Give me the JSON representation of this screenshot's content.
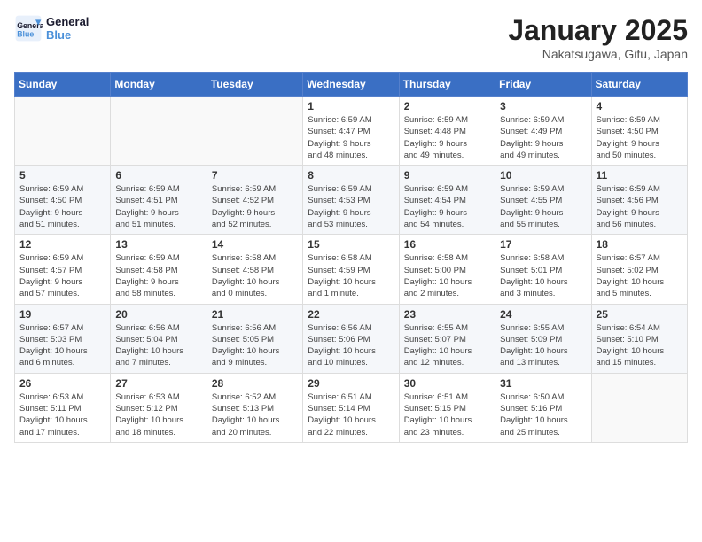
{
  "logo": {
    "line1": "General",
    "line2": "Blue"
  },
  "title": "January 2025",
  "location": "Nakatsugawa, Gifu, Japan",
  "weekdays": [
    "Sunday",
    "Monday",
    "Tuesday",
    "Wednesday",
    "Thursday",
    "Friday",
    "Saturday"
  ],
  "weeks": [
    [
      {
        "day": "",
        "info": ""
      },
      {
        "day": "",
        "info": ""
      },
      {
        "day": "",
        "info": ""
      },
      {
        "day": "1",
        "info": "Sunrise: 6:59 AM\nSunset: 4:47 PM\nDaylight: 9 hours\nand 48 minutes."
      },
      {
        "day": "2",
        "info": "Sunrise: 6:59 AM\nSunset: 4:48 PM\nDaylight: 9 hours\nand 49 minutes."
      },
      {
        "day": "3",
        "info": "Sunrise: 6:59 AM\nSunset: 4:49 PM\nDaylight: 9 hours\nand 49 minutes."
      },
      {
        "day": "4",
        "info": "Sunrise: 6:59 AM\nSunset: 4:50 PM\nDaylight: 9 hours\nand 50 minutes."
      }
    ],
    [
      {
        "day": "5",
        "info": "Sunrise: 6:59 AM\nSunset: 4:50 PM\nDaylight: 9 hours\nand 51 minutes."
      },
      {
        "day": "6",
        "info": "Sunrise: 6:59 AM\nSunset: 4:51 PM\nDaylight: 9 hours\nand 51 minutes."
      },
      {
        "day": "7",
        "info": "Sunrise: 6:59 AM\nSunset: 4:52 PM\nDaylight: 9 hours\nand 52 minutes."
      },
      {
        "day": "8",
        "info": "Sunrise: 6:59 AM\nSunset: 4:53 PM\nDaylight: 9 hours\nand 53 minutes."
      },
      {
        "day": "9",
        "info": "Sunrise: 6:59 AM\nSunset: 4:54 PM\nDaylight: 9 hours\nand 54 minutes."
      },
      {
        "day": "10",
        "info": "Sunrise: 6:59 AM\nSunset: 4:55 PM\nDaylight: 9 hours\nand 55 minutes."
      },
      {
        "day": "11",
        "info": "Sunrise: 6:59 AM\nSunset: 4:56 PM\nDaylight: 9 hours\nand 56 minutes."
      }
    ],
    [
      {
        "day": "12",
        "info": "Sunrise: 6:59 AM\nSunset: 4:57 PM\nDaylight: 9 hours\nand 57 minutes."
      },
      {
        "day": "13",
        "info": "Sunrise: 6:59 AM\nSunset: 4:58 PM\nDaylight: 9 hours\nand 58 minutes."
      },
      {
        "day": "14",
        "info": "Sunrise: 6:58 AM\nSunset: 4:58 PM\nDaylight: 10 hours\nand 0 minutes."
      },
      {
        "day": "15",
        "info": "Sunrise: 6:58 AM\nSunset: 4:59 PM\nDaylight: 10 hours\nand 1 minute."
      },
      {
        "day": "16",
        "info": "Sunrise: 6:58 AM\nSunset: 5:00 PM\nDaylight: 10 hours\nand 2 minutes."
      },
      {
        "day": "17",
        "info": "Sunrise: 6:58 AM\nSunset: 5:01 PM\nDaylight: 10 hours\nand 3 minutes."
      },
      {
        "day": "18",
        "info": "Sunrise: 6:57 AM\nSunset: 5:02 PM\nDaylight: 10 hours\nand 5 minutes."
      }
    ],
    [
      {
        "day": "19",
        "info": "Sunrise: 6:57 AM\nSunset: 5:03 PM\nDaylight: 10 hours\nand 6 minutes."
      },
      {
        "day": "20",
        "info": "Sunrise: 6:56 AM\nSunset: 5:04 PM\nDaylight: 10 hours\nand 7 minutes."
      },
      {
        "day": "21",
        "info": "Sunrise: 6:56 AM\nSunset: 5:05 PM\nDaylight: 10 hours\nand 9 minutes."
      },
      {
        "day": "22",
        "info": "Sunrise: 6:56 AM\nSunset: 5:06 PM\nDaylight: 10 hours\nand 10 minutes."
      },
      {
        "day": "23",
        "info": "Sunrise: 6:55 AM\nSunset: 5:07 PM\nDaylight: 10 hours\nand 12 minutes."
      },
      {
        "day": "24",
        "info": "Sunrise: 6:55 AM\nSunset: 5:09 PM\nDaylight: 10 hours\nand 13 minutes."
      },
      {
        "day": "25",
        "info": "Sunrise: 6:54 AM\nSunset: 5:10 PM\nDaylight: 10 hours\nand 15 minutes."
      }
    ],
    [
      {
        "day": "26",
        "info": "Sunrise: 6:53 AM\nSunset: 5:11 PM\nDaylight: 10 hours\nand 17 minutes."
      },
      {
        "day": "27",
        "info": "Sunrise: 6:53 AM\nSunset: 5:12 PM\nDaylight: 10 hours\nand 18 minutes."
      },
      {
        "day": "28",
        "info": "Sunrise: 6:52 AM\nSunset: 5:13 PM\nDaylight: 10 hours\nand 20 minutes."
      },
      {
        "day": "29",
        "info": "Sunrise: 6:51 AM\nSunset: 5:14 PM\nDaylight: 10 hours\nand 22 minutes."
      },
      {
        "day": "30",
        "info": "Sunrise: 6:51 AM\nSunset: 5:15 PM\nDaylight: 10 hours\nand 23 minutes."
      },
      {
        "day": "31",
        "info": "Sunrise: 6:50 AM\nSunset: 5:16 PM\nDaylight: 10 hours\nand 25 minutes."
      },
      {
        "day": "",
        "info": ""
      }
    ]
  ]
}
